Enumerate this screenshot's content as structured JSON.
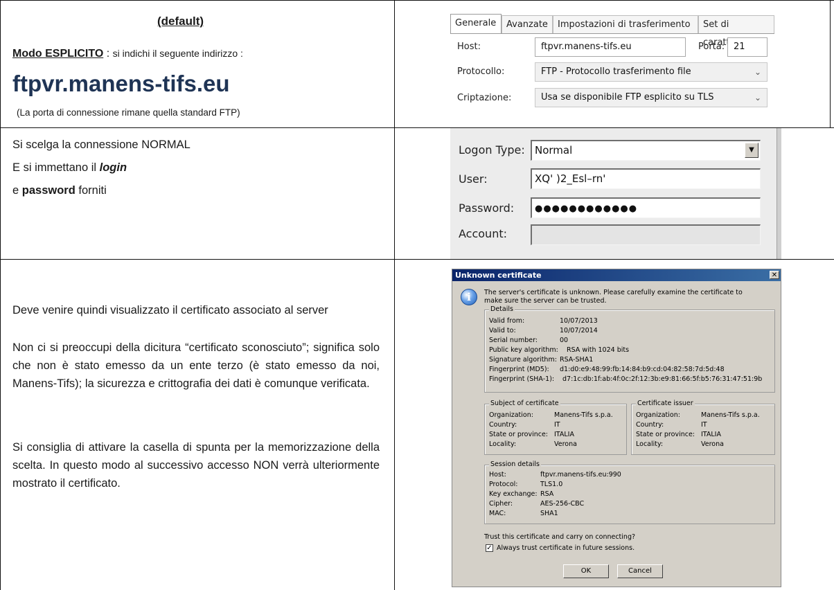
{
  "row1": {
    "default_label": "(default)",
    "mode_label": "Modo ESPLICITO",
    "mode_colon": " : ",
    "mode_instruction": "si indichi il seguente indirizzo :",
    "host_big": "ftpvr.manens-tifs.eu",
    "port_note": "(La porta di connessione rimane quella standard FTP)"
  },
  "general_panel": {
    "tabs": [
      "Generale",
      "Avanzate",
      "Impostazioni di trasferimento",
      "Set di caratteri"
    ],
    "host_label": "Host:",
    "host_value": "ftpvr.manens-tifs.eu",
    "port_label": "Porta:",
    "port_value": "21",
    "protocol_label": "Protocollo:",
    "protocol_value": "FTP - Protocollo trasferimento file",
    "encryption_label": "Criptazione:",
    "encryption_value": "Usa se disponibile FTP esplicito su TLS"
  },
  "row2": {
    "line1": "Si scelga la connessione NORMAL",
    "line2_prefix": "E si immettano il ",
    "line2_bold": "login",
    "line3_prefix": "e ",
    "line3_bold": "password",
    "line3_suffix": " forniti"
  },
  "logon_panel": {
    "logon_type_label": "Logon Type:",
    "logon_type_value": "Normal",
    "user_label": "User:",
    "user_value": "XQ' )2_Esl–rn'",
    "password_label": "Password:",
    "password_value": "●●●●●●●●●●●●",
    "account_label": "Account:",
    "account_value": ""
  },
  "row3": {
    "para1": "Deve venire quindi visualizzato il certificato associato al server",
    "para2": "Non ci si preoccupi della dicitura “certificato sconosciuto”; significa solo che non è stato emesso da un ente terzo (è stato emesso da noi, Manens-Tifs); la sicurezza e crittografia dei dati è comunque verificata.",
    "para3": "Si consiglia di attivare la casella di spunta per la memorizzazione della scelta. In questo modo al successivo accesso NON verrà ulteriormente mostrato il certificato."
  },
  "cert_dialog": {
    "title": "Unknown certificate",
    "intro_line1": "The server's certificate is unknown. Please carefully examine the certificate to",
    "intro_line2": "make sure the server can be trusted.",
    "details_title": "Details",
    "details": [
      {
        "k": "Valid from:",
        "v": "10/07/2013"
      },
      {
        "k": "Valid to:",
        "v": "10/07/2014"
      },
      {
        "k": "Serial number:",
        "v": "00"
      },
      {
        "k": "Public key algorithm:",
        "v": "RSA with 1024 bits"
      },
      {
        "k": "Signature algorithm:",
        "v": "RSA-SHA1"
      },
      {
        "k": "Fingerprint (MD5):",
        "v": "d1:d0:e9:48:99:fb:14:84:b9:cd:04:82:58:7d:5d:48"
      },
      {
        "k": "Fingerprint (SHA-1):",
        "v": "d7:1c:db:1f:ab:4f:0c:2f:12:3b:e9:81:66:5f:b5:76:31:47:51:9b"
      }
    ],
    "subject_title": "Subject of certificate",
    "issuer_title": "Certificate issuer",
    "subject": [
      {
        "k": "Organization:",
        "v": "Manens-Tifs s.p.a."
      },
      {
        "k": "Country:",
        "v": "IT"
      },
      {
        "k": "State or province:",
        "v": "ITALIA"
      },
      {
        "k": "Locality:",
        "v": "Verona"
      }
    ],
    "issuer": [
      {
        "k": "Organization:",
        "v": "Manens-Tifs s.p.a."
      },
      {
        "k": "Country:",
        "v": "IT"
      },
      {
        "k": "State or province:",
        "v": "ITALIA"
      },
      {
        "k": "Locality:",
        "v": "Verona"
      }
    ],
    "session_title": "Session details",
    "session": [
      {
        "k": "Host:",
        "v": "ftpvr.manens-tifs.eu:990"
      },
      {
        "k": "Protocol:",
        "v": "TLS1.0"
      },
      {
        "k": "Key exchange:",
        "v": "RSA"
      },
      {
        "k": "Cipher:",
        "v": "AES-256-CBC"
      },
      {
        "k": "MAC:",
        "v": "SHA1"
      }
    ],
    "trust_question": "Trust this certificate and carry on connecting?",
    "always_trust_label": "Always trust certificate in future sessions.",
    "always_trust_checked": "✓",
    "ok_label": "OK",
    "cancel_label": "Cancel",
    "info_icon": "i"
  }
}
